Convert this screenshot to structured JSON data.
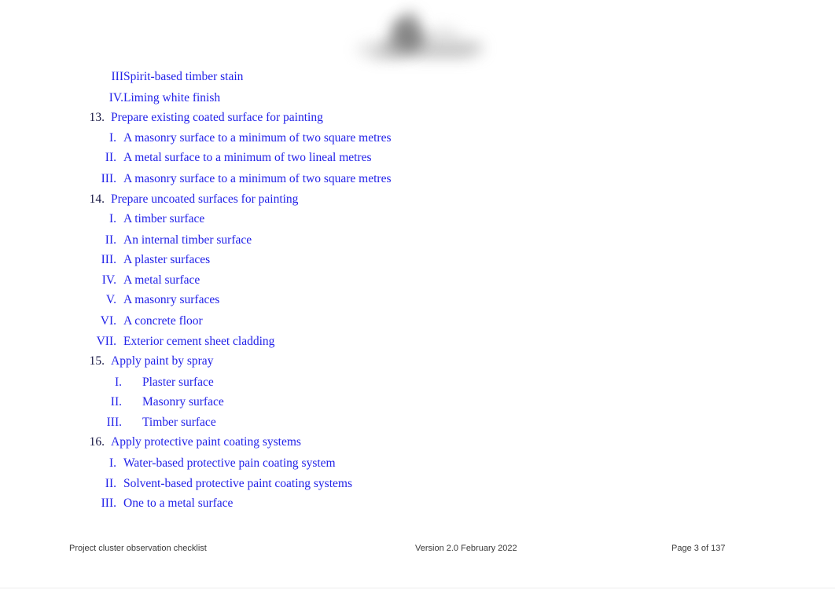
{
  "document": {
    "title": "Project cluster observation checklist",
    "text_color": "#2222e8",
    "number_color": "#1a1a46",
    "background": "#ffffff"
  },
  "logo": {
    "name": "blurred-organisation-logo",
    "description": "blurred grayscale logo watermark"
  },
  "content": {
    "lines": [
      {
        "kind": "roman",
        "marker": "III",
        "text": "Spirit-based timber stain",
        "gap": "none"
      },
      {
        "kind": "roman",
        "marker": "IV.",
        "text": "Liming white finish",
        "gap": "none"
      },
      {
        "kind": "number",
        "marker": "13.",
        "text": "Prepare existing coated surface for painting"
      },
      {
        "kind": "roman",
        "marker": "I.",
        "text": "A masonry surface to a minimum of two square metres",
        "gap": "sm"
      },
      {
        "kind": "roman",
        "marker": "II.",
        "text": "A metal surface to a minimum of two lineal metres",
        "gap": "sm"
      },
      {
        "kind": "roman",
        "marker": "III.",
        "text": "A masonry surface to a minimum of two square metres",
        "gap": "sm"
      },
      {
        "kind": "number",
        "marker": "14.",
        "text": "Prepare uncoated surfaces for painting"
      },
      {
        "kind": "roman",
        "marker": "I.",
        "text": "A timber surface",
        "gap": "sm"
      },
      {
        "kind": "roman",
        "marker": "II.",
        "text": "An internal timber surface",
        "gap": "sm"
      },
      {
        "kind": "roman",
        "marker": "III.",
        "text": "A plaster surfaces",
        "gap": "sm"
      },
      {
        "kind": "roman",
        "marker": "IV.",
        "text": "A metal surface",
        "gap": "sm"
      },
      {
        "kind": "roman",
        "marker": "V.",
        "text": "A masonry surfaces",
        "gap": "sm"
      },
      {
        "kind": "roman",
        "marker": "VI.",
        "text": "A concrete floor",
        "gap": "sm"
      },
      {
        "kind": "roman",
        "marker": "VII.",
        "text": "Exterior cement sheet cladding",
        "gap": "sm"
      },
      {
        "kind": "number",
        "marker": "15.",
        "text": "Apply paint by spray"
      },
      {
        "kind": "roman",
        "marker": "I.",
        "text": "Plaster surface",
        "gap": "lg"
      },
      {
        "kind": "roman",
        "marker": "II.",
        "text": "Masonry surface",
        "gap": "lg"
      },
      {
        "kind": "roman",
        "marker": "III.",
        "text": "Timber surface",
        "gap": "lg"
      },
      {
        "kind": "number",
        "marker": "16.",
        "text": "Apply protective paint coating systems"
      },
      {
        "kind": "roman",
        "marker": "I.",
        "text": "Water-based protective pain coating system",
        "gap": "sm"
      },
      {
        "kind": "roman",
        "marker": "II.",
        "text": "Solvent-based protective paint coating systems",
        "gap": "sm"
      },
      {
        "kind": "roman",
        "marker": "III.",
        "text": "One to a metal surface",
        "gap": "sm"
      }
    ]
  },
  "footer": {
    "left": "Project cluster observation checklist",
    "center": "Version 2.0 February 2022",
    "right": "Page 3 of 137"
  }
}
